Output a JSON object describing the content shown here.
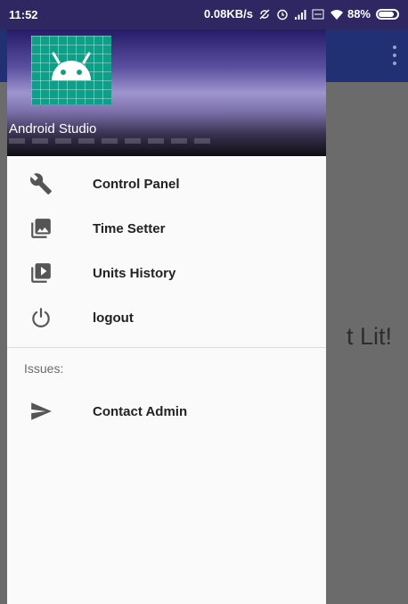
{
  "status_bar": {
    "time": "11:52",
    "network_speed": "0.08KB/s",
    "battery_percent": "88%",
    "battery_level": 0.88,
    "icons": [
      "no-sync-icon",
      "alarm-icon",
      "signal-icon",
      "volte-icon",
      "wifi-icon",
      "battery-icon"
    ]
  },
  "app": {
    "background_text": "t Lit!",
    "toolbar_color": "#213072"
  },
  "drawer": {
    "header": {
      "name": "Android Studio",
      "logo_color": "#0f9e88"
    },
    "items": [
      {
        "label": "Control Panel",
        "icon": "wrench-icon"
      },
      {
        "label": "Time Setter",
        "icon": "image-gallery-icon"
      },
      {
        "label": "Units History",
        "icon": "video-library-icon"
      },
      {
        "label": "logout",
        "icon": "power-icon"
      }
    ],
    "section": {
      "title": "Issues:",
      "items": [
        {
          "label": "Contact Admin",
          "icon": "send-icon"
        }
      ]
    }
  }
}
